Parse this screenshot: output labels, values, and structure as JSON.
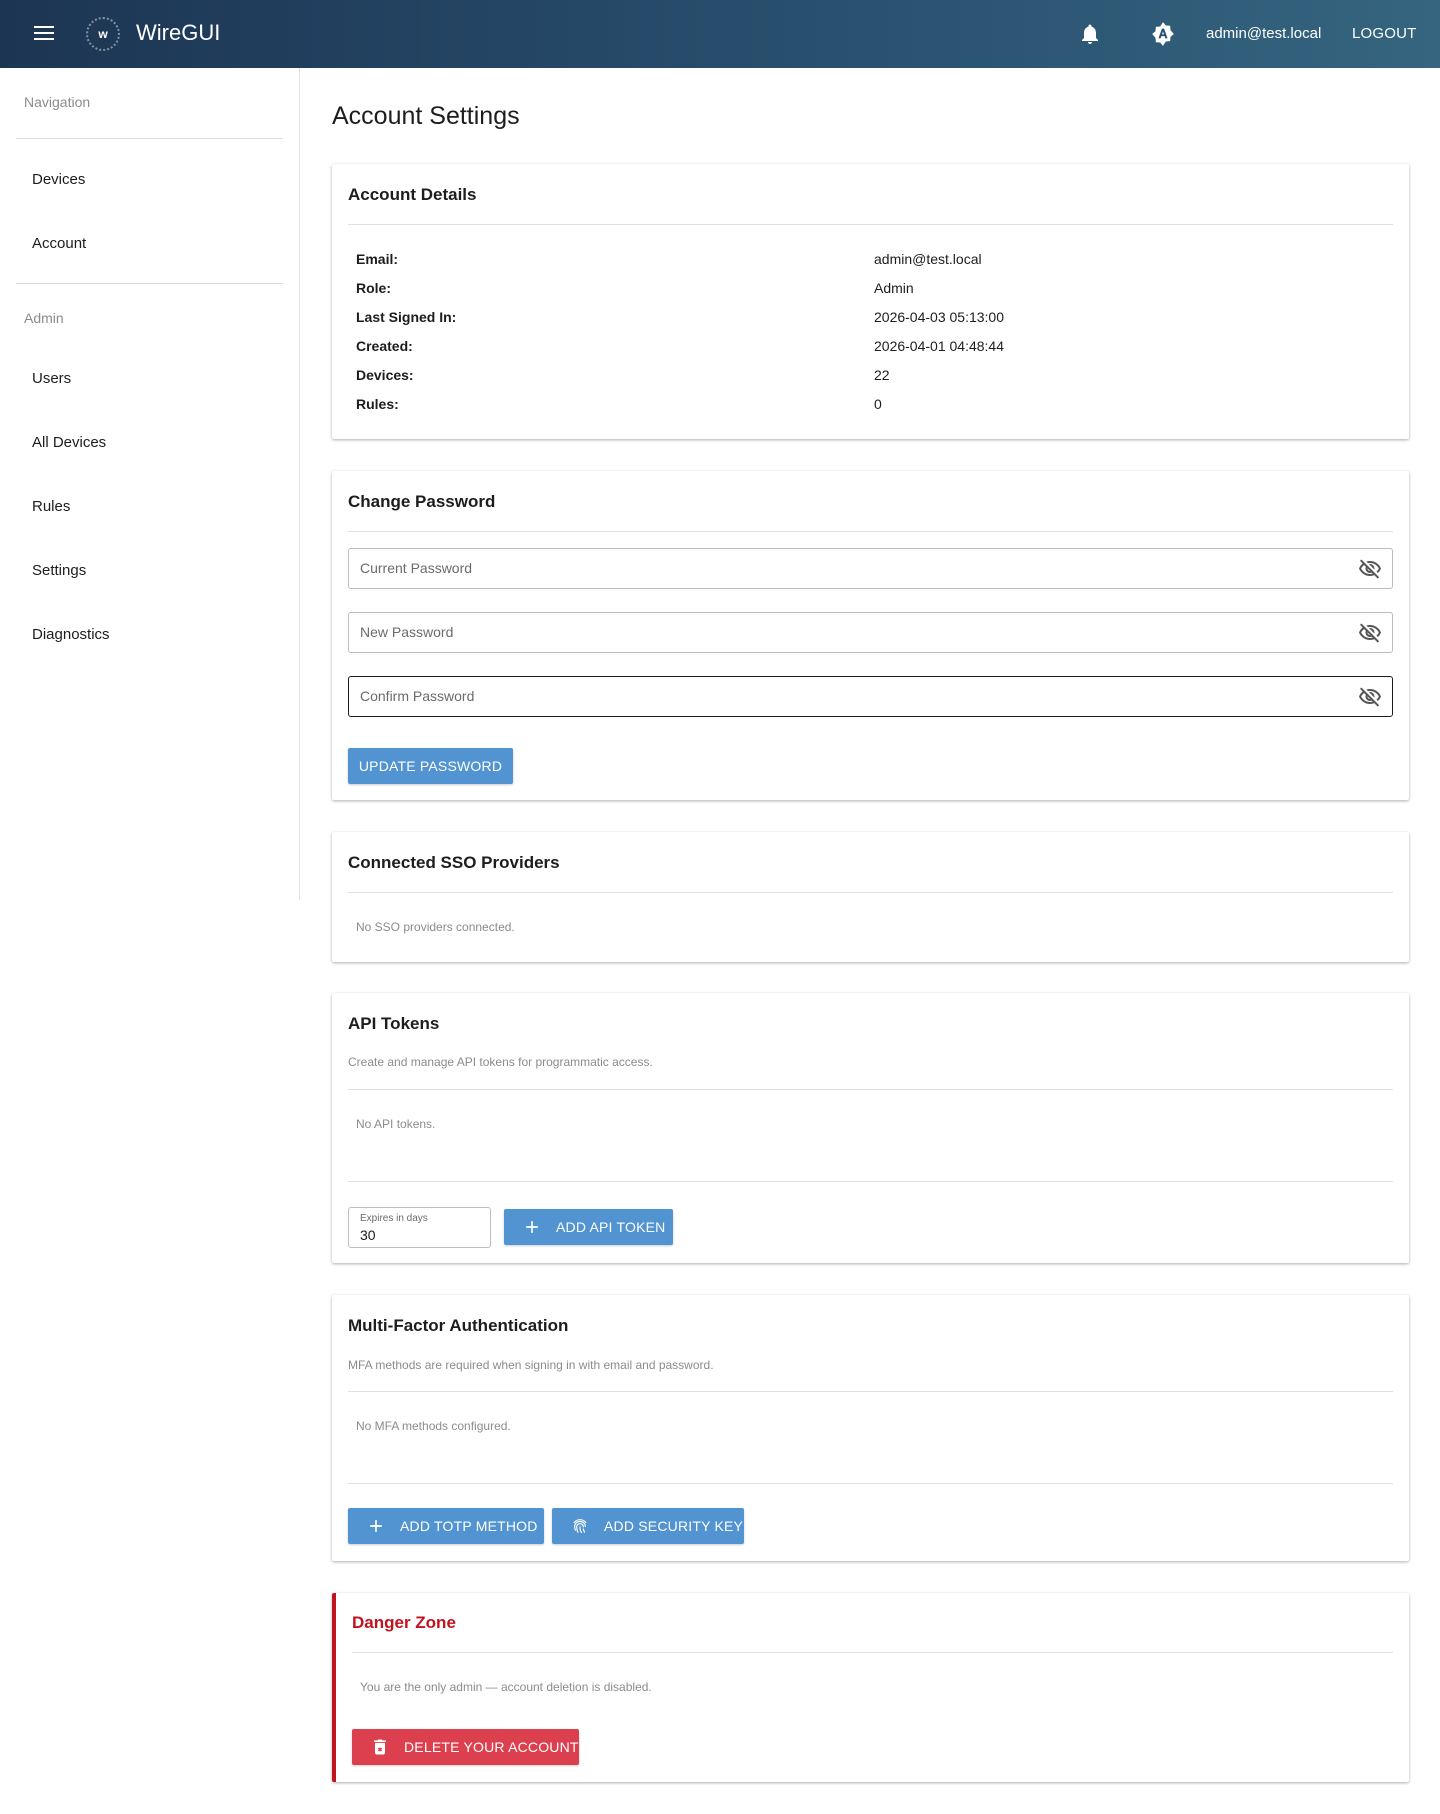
{
  "header": {
    "app_title": "WireGUI",
    "logo_letter": "w",
    "user_email": "admin@test.local",
    "logout_label": "LOGOUT",
    "icons": [
      "menu-icon",
      "bell-icon",
      "theme-icon"
    ]
  },
  "sidebar": {
    "navigation_heading": "Navigation",
    "navigation_items": [
      {
        "label": "Devices"
      },
      {
        "label": "Account"
      }
    ],
    "admin_heading": "Admin",
    "admin_items": [
      {
        "label": "Users"
      },
      {
        "label": "All Devices"
      },
      {
        "label": "Rules"
      },
      {
        "label": "Settings"
      },
      {
        "label": "Diagnostics"
      }
    ]
  },
  "page": {
    "title": "Account Settings"
  },
  "account_details": {
    "title": "Account Details",
    "rows": [
      {
        "label": "Email:",
        "value": "admin@test.local"
      },
      {
        "label": "Role:",
        "value": "Admin"
      },
      {
        "label": "Last Signed In:",
        "value": "2026-04-03 05:13:00"
      },
      {
        "label": "Created:",
        "value": "2026-04-01 04:48:44"
      },
      {
        "label": "Devices:",
        "value": "22"
      },
      {
        "label": "Rules:",
        "value": "0"
      }
    ]
  },
  "change_password": {
    "title": "Change Password",
    "current_placeholder": "Current Password",
    "new_placeholder": "New Password",
    "confirm_placeholder": "Confirm Password",
    "update_label": "UPDATE PASSWORD"
  },
  "sso": {
    "title": "Connected SSO Providers",
    "empty_text": "No SSO providers connected."
  },
  "api_tokens": {
    "title": "API Tokens",
    "subtitle": "Create and manage API tokens for programmatic access.",
    "empty_text": "No API tokens.",
    "expires_label": "Expires in days",
    "expires_value": "30",
    "add_label": "ADD API TOKEN"
  },
  "mfa": {
    "title": "Multi-Factor Authentication",
    "subtitle": "MFA methods are required when signing in with email and password.",
    "empty_text": "No MFA methods configured.",
    "add_totp_label": "ADD TOTP METHOD",
    "add_key_label": "ADD SECURITY KEY"
  },
  "danger_zone": {
    "title": "Danger Zone",
    "note": "You are the only admin — account deletion is disabled.",
    "delete_label": "DELETE YOUR ACCOUNT"
  },
  "colors": {
    "header_start": "#1c3553",
    "header_end": "#35657f",
    "primary_button": "#5294d1",
    "danger_button": "#dc3f4e",
    "danger_accent": "#c1121f"
  }
}
